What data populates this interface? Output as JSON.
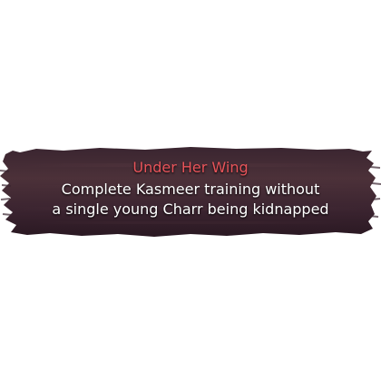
{
  "achievement": {
    "title": "Under Her Wing",
    "description_lines": [
      "Complete Kasmeer training without",
      "a single young Charr being kidnapped"
    ]
  },
  "colors": {
    "title": "#e8545a",
    "description": "#ffffff",
    "banner_dark": "#2a1822",
    "banner_mid": "#4a3038",
    "background": "#ffffff"
  }
}
